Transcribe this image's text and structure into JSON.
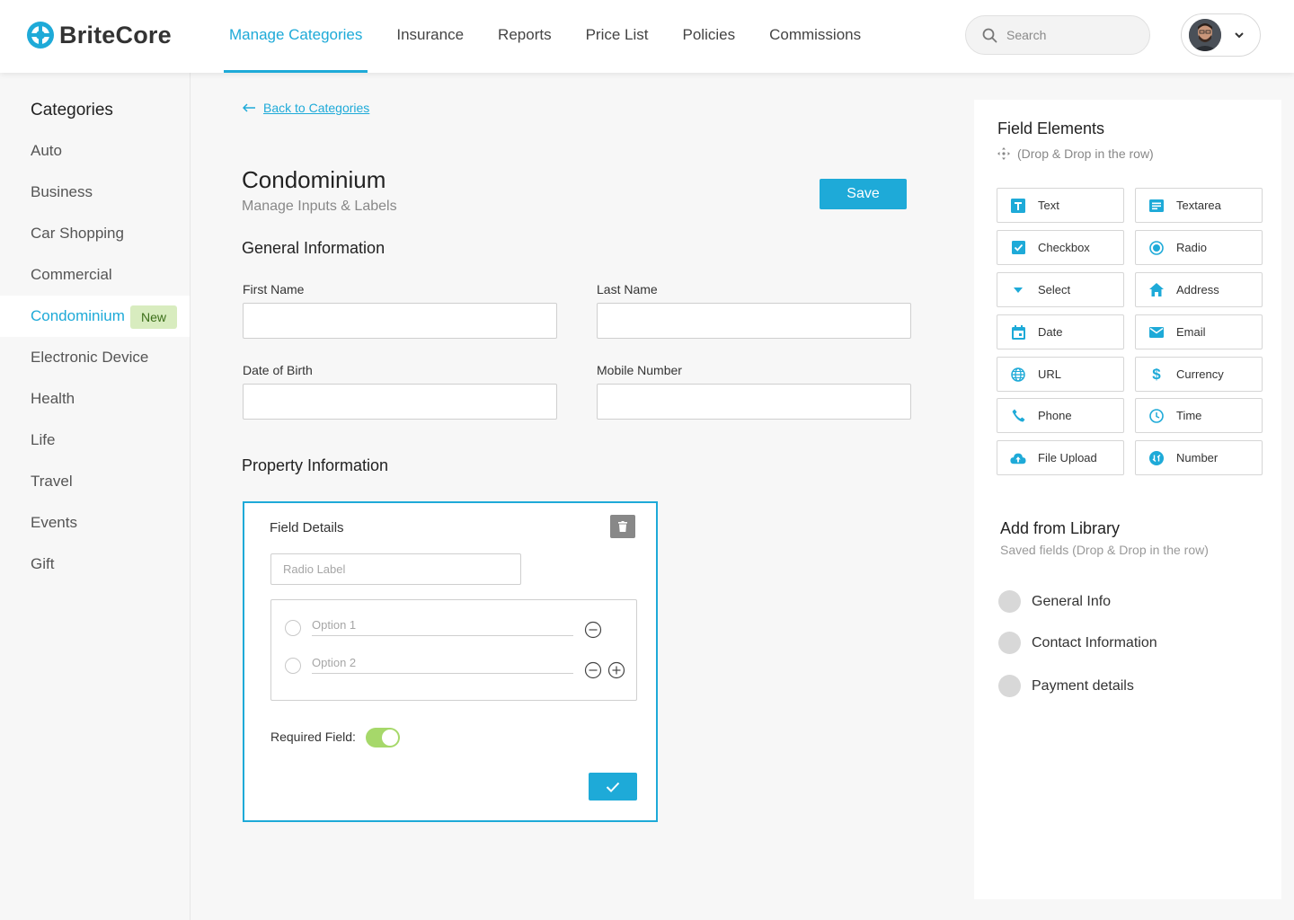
{
  "brand": {
    "name": "BriteCore",
    "accent_color": "#1eaad8"
  },
  "nav": {
    "items": [
      {
        "label": "Manage Categories",
        "active": true
      },
      {
        "label": "Insurance",
        "active": false
      },
      {
        "label": "Reports",
        "active": false
      },
      {
        "label": "Price List",
        "active": false
      },
      {
        "label": "Policies",
        "active": false
      },
      {
        "label": "Commissions",
        "active": false
      }
    ]
  },
  "search": {
    "placeholder": "Search",
    "icon": "search-icon"
  },
  "user_menu": {
    "icon": "chevron-down-icon"
  },
  "sidebar": {
    "title": "Categories",
    "items": [
      {
        "label": "Auto"
      },
      {
        "label": "Business"
      },
      {
        "label": "Car Shopping"
      },
      {
        "label": "Commercial"
      },
      {
        "label": "Condominium",
        "active": true,
        "badge": "New"
      },
      {
        "label": "Electronic Device"
      },
      {
        "label": "Health"
      },
      {
        "label": "Life"
      },
      {
        "label": "Travel"
      },
      {
        "label": "Events"
      },
      {
        "label": "Gift"
      }
    ]
  },
  "main": {
    "back_link": "Back to Categories",
    "title": "Condominium",
    "subtitle": "Manage Inputs & Labels",
    "save_label": "Save",
    "general_section": "General Information",
    "fields": {
      "first_name": "First Name",
      "last_name": "Last Name",
      "dob": "Date of Birth",
      "mobile": "Mobile Number"
    },
    "property_section": "Property Information"
  },
  "field_details": {
    "title": "Field Details",
    "radio_label_placeholder": "Radio Label",
    "option1_placeholder": "Option 1",
    "option2_placeholder": "Option 2",
    "required_label": "Required Field:",
    "required_on": true
  },
  "field_elements": {
    "title": "Field Elements",
    "hint": "(Drop & Drop in the row)",
    "items": [
      {
        "label": "Text",
        "icon": "text-icon"
      },
      {
        "label": "Textarea",
        "icon": "textarea-icon"
      },
      {
        "label": "Checkbox",
        "icon": "checkbox-icon"
      },
      {
        "label": "Radio",
        "icon": "radio-icon"
      },
      {
        "label": "Select",
        "icon": "caret-down-icon"
      },
      {
        "label": "Address",
        "icon": "home-icon"
      },
      {
        "label": "Date",
        "icon": "calendar-icon"
      },
      {
        "label": "Email",
        "icon": "mail-icon"
      },
      {
        "label": "URL",
        "icon": "globe-icon"
      },
      {
        "label": "Currency",
        "icon": "dollar-icon"
      },
      {
        "label": "Phone",
        "icon": "phone-icon"
      },
      {
        "label": "Time",
        "icon": "clock-icon"
      },
      {
        "label": "File Upload",
        "icon": "cloud-upload-icon"
      },
      {
        "label": "Number",
        "icon": "number-icon"
      }
    ]
  },
  "library": {
    "title": "Add from Library",
    "subtitle": "Saved fields (Drop & Drop in the row)",
    "items": [
      {
        "label": "General Info"
      },
      {
        "label": "Contact Information"
      },
      {
        "label": "Payment details"
      }
    ]
  }
}
